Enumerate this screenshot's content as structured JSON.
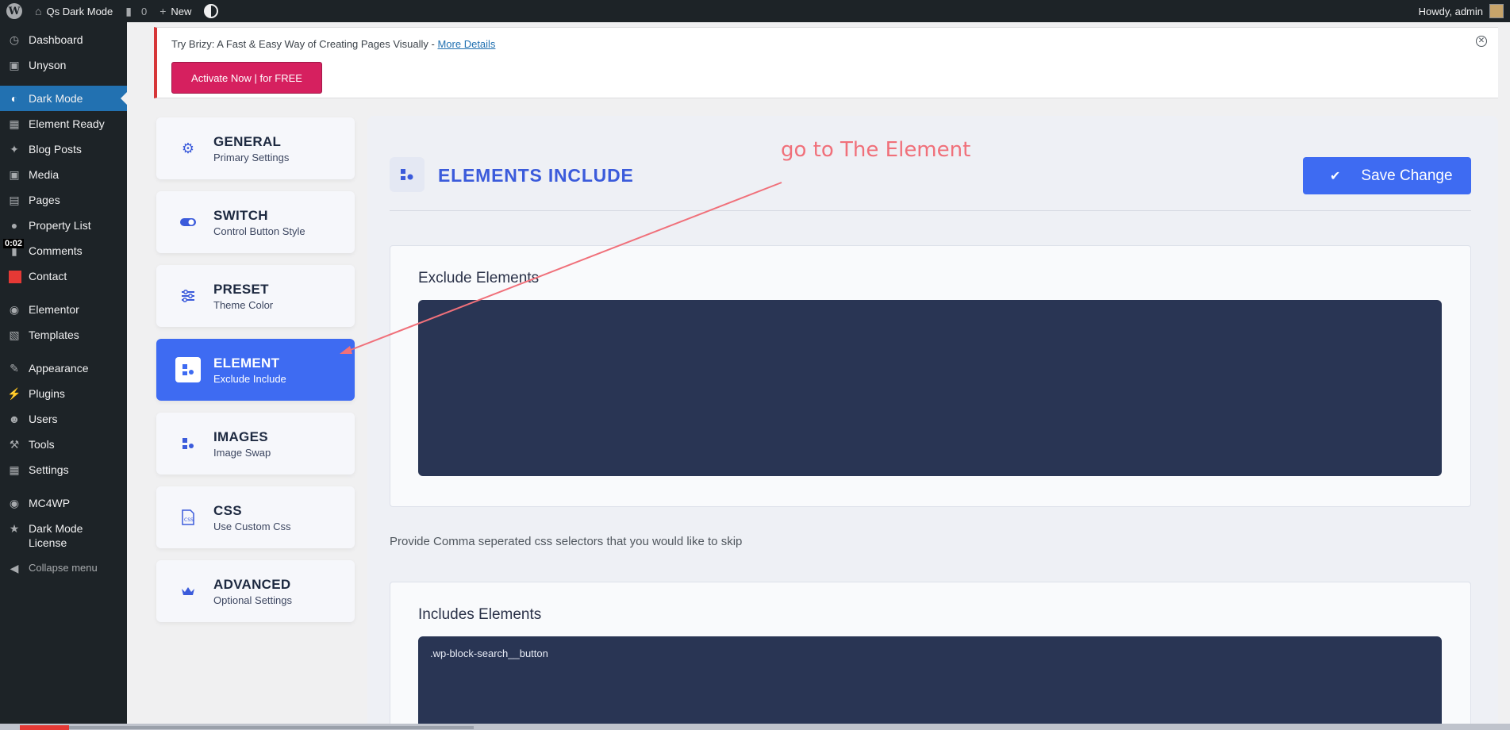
{
  "adminbar": {
    "site_name": "Qs Dark Mode",
    "comments_count": "0",
    "new_label": "New",
    "howdy": "Howdy, admin"
  },
  "sidebar": {
    "items": [
      {
        "label": "Dashboard",
        "icon": "dashboard-icon"
      },
      {
        "label": "Unyson",
        "icon": "unyson-icon"
      },
      {
        "label": "Dark Mode",
        "icon": "dark-mode-icon",
        "active": true
      },
      {
        "label": "Element Ready",
        "icon": "element-ready-icon"
      },
      {
        "label": "Blog Posts",
        "icon": "pin-icon"
      },
      {
        "label": "Media",
        "icon": "media-icon"
      },
      {
        "label": "Pages",
        "icon": "pages-icon"
      },
      {
        "label": "Property List",
        "icon": "property-icon"
      },
      {
        "label": "Comments",
        "icon": "comments-icon"
      },
      {
        "label": "Contact",
        "icon": "mail-icon"
      },
      {
        "label": "Elementor",
        "icon": "elementor-icon"
      },
      {
        "label": "Templates",
        "icon": "folder-icon"
      },
      {
        "label": "Appearance",
        "icon": "brush-icon"
      },
      {
        "label": "Plugins",
        "icon": "plug-icon"
      },
      {
        "label": "Users",
        "icon": "user-icon"
      },
      {
        "label": "Tools",
        "icon": "wrench-icon"
      },
      {
        "label": "Settings",
        "icon": "settings-icon"
      },
      {
        "label": "MC4WP",
        "icon": "mc4wp-icon"
      },
      {
        "label": "Dark Mode License",
        "icon": "star-icon"
      },
      {
        "label": "Collapse menu",
        "icon": "collapse-icon"
      }
    ],
    "video_time": "0:02"
  },
  "notice": {
    "text": "Try Brizy: A Fast & Easy Way of Creating Pages Visually - ",
    "link": "More Details",
    "button": "Activate Now | for FREE"
  },
  "tabs": [
    {
      "title": "GENERAL",
      "subtitle": "Primary Settings",
      "icon": "gear-icon"
    },
    {
      "title": "SWITCH",
      "subtitle": "Control Button Style",
      "icon": "toggle-icon"
    },
    {
      "title": "PRESET",
      "subtitle": "Theme Color",
      "icon": "sliders-icon"
    },
    {
      "title": "ELEMENT",
      "subtitle": "Exclude Include",
      "icon": "element-icon",
      "active": true
    },
    {
      "title": "IMAGES",
      "subtitle": "Image Swap",
      "icon": "images-icon"
    },
    {
      "title": "CSS",
      "subtitle": "Use Custom Css",
      "icon": "css-icon"
    },
    {
      "title": "ADVANCED",
      "subtitle": "Optional Settings",
      "icon": "crown-icon"
    }
  ],
  "panel": {
    "title": "ELEMENTS INCLUDE",
    "save_label": "Save Change",
    "exclude_label": "Exclude Elements",
    "exclude_value": "",
    "hint": "Provide Comma seperated css selectors that you would like to skip",
    "include_label": "Includes Elements",
    "include_value": ".wp-block-search__button"
  },
  "annotation": "go to The Element",
  "colors": {
    "accent": "#3e6bf2",
    "sidebar_bg": "#1d2327",
    "active_menu": "#2271b1",
    "notice_button": "#d6205f",
    "textarea_bg": "#293554",
    "annotation": "#f0707a"
  }
}
